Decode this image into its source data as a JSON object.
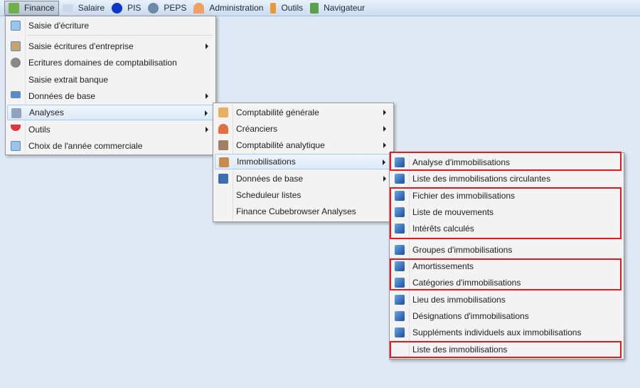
{
  "menubar": {
    "items": [
      {
        "label": "Finance",
        "icon": "money-icon",
        "active": true
      },
      {
        "label": "Salaire",
        "icon": "id-card-icon"
      },
      {
        "label": "PIS",
        "icon": "info-icon"
      },
      {
        "label": "PEPS",
        "icon": "info-grey-icon"
      },
      {
        "label": "Administration",
        "icon": "satellite-icon"
      },
      {
        "label": "Outils",
        "icon": "wrench-icon"
      },
      {
        "label": "Navigateur",
        "icon": "sync-arrows-icon"
      }
    ]
  },
  "finance_menu": {
    "items": [
      {
        "label": "Saisie d'écriture",
        "icon": "calendar-icon"
      },
      {
        "label": "Saisie écritures d'entreprise",
        "icon": "house-icon",
        "submenu": true
      },
      {
        "label": "Ecritures domaines de comptabilisation",
        "icon": "disc-icon"
      },
      {
        "label": "Saisie extrait banque"
      },
      {
        "label": "Données de base",
        "icon": "windows-icon",
        "submenu": true
      },
      {
        "label": "Analyses",
        "icon": "printer-icon",
        "submenu": true,
        "highlighted": true
      },
      {
        "label": "Outils",
        "icon": "gem-icon",
        "submenu": true
      },
      {
        "label": "Choix de l'année commerciale",
        "icon": "calendar-icon"
      }
    ]
  },
  "analyses_menu": {
    "items": [
      {
        "label": "Comptabilité générale",
        "icon": "ledger-icon",
        "submenu": true
      },
      {
        "label": "Créanciers",
        "icon": "person-icon",
        "submenu": true
      },
      {
        "label": "Comptabilité analytique",
        "icon": "truck-icon",
        "submenu": true
      },
      {
        "label": "Immobilisations",
        "icon": "house-icon",
        "submenu": true,
        "highlighted": true
      },
      {
        "label": "Données de base",
        "icon": "book-icon",
        "submenu": true
      },
      {
        "label": "Scheduleur listes"
      },
      {
        "label": "Finance Cubebrowser Analyses"
      }
    ]
  },
  "immobilisations_menu": {
    "items": [
      {
        "label": "Analyse d'immobilisations",
        "icon": "report-icon"
      },
      {
        "label": "Liste des immobilisations circulantes",
        "icon": "report-icon"
      },
      {
        "label": "Fichier des immobilisations",
        "icon": "report-icon"
      },
      {
        "label": "Liste de mouvements",
        "icon": "report-icon"
      },
      {
        "label": "Intérêts calculés",
        "icon": "report-icon"
      },
      {
        "label": "Groupes d'immobilisations",
        "icon": "report-icon"
      },
      {
        "label": "Amortissements",
        "icon": "report-icon"
      },
      {
        "label": "Catégories d'immobilisations",
        "icon": "report-icon"
      },
      {
        "label": "Lieu des immobilisations",
        "icon": "report-icon"
      },
      {
        "label": "Désignations d'immobilisations",
        "icon": "report-icon"
      },
      {
        "label": "Suppléments individuels aux immobilisations",
        "icon": "report-icon"
      },
      {
        "label": "Liste des immobilisations"
      }
    ]
  },
  "colors": {
    "highlight_box": "#e21b1b"
  }
}
